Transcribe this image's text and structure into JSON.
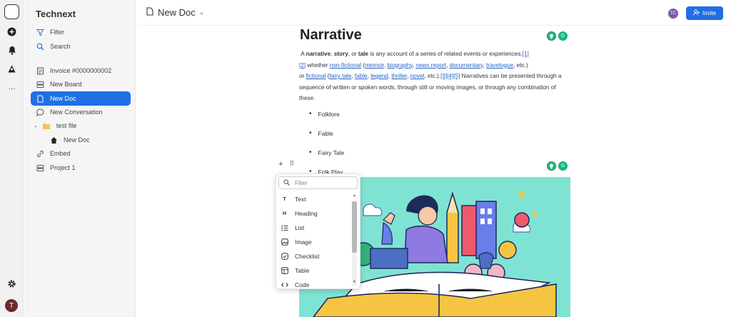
{
  "app": {
    "name": "Technext"
  },
  "rail": {
    "icons": [
      "app-logo-icon",
      "plus-circle-icon",
      "bell-icon",
      "spaces-icon",
      "more-icon",
      "settings-gear-icon"
    ],
    "avatar_initial": "T"
  },
  "sidebar": {
    "filter_label": "Filter",
    "search_label": "Search",
    "items": [
      {
        "label": "Invoice #0000000002",
        "icon": "invoice-icon"
      },
      {
        "label": "New Board",
        "icon": "board-icon"
      },
      {
        "label": "New Doc",
        "icon": "doc-icon",
        "active": true
      },
      {
        "label": "New Conversation",
        "icon": "chat-icon"
      },
      {
        "label": "test file",
        "icon": "folder-icon"
      },
      {
        "label": "New Doc",
        "icon": "home-icon"
      },
      {
        "label": "Embed",
        "icon": "link-icon"
      },
      {
        "label": "Project 1",
        "icon": "project-icon"
      }
    ]
  },
  "topbar": {
    "doc_title": "New Doc",
    "user_initials": "TC",
    "invite_label": "Invite"
  },
  "document": {
    "heading": "Narrative",
    "para": {
      "t1": "A ",
      "b1": "narrative",
      "t2": ", ",
      "b2": "story",
      "t3": ", or ",
      "b3": "tale",
      "t4": " is any account of a series of related events or experiences.",
      "r1": "[1]",
      "r2": "[2]",
      "t5": " whether ",
      "l1": "non-fictional",
      "t6": " (",
      "l2": "memoir",
      "t7": ", ",
      "l3": "biography",
      "t8": ", ",
      "l4": "news report",
      "t9": ", ",
      "l5": "documentary",
      "t10": ", ",
      "l6": "travelogue",
      "t11": ", etc.)",
      "t12": "or ",
      "l7": "fictional",
      "t13": " (",
      "l8": "fairy tale",
      "t14": ", ",
      "l9": "fable",
      "t15": ", ",
      "l10": "legend",
      "t16": ", ",
      "l11": "thriller",
      "t17": ", ",
      "l12": "novel",
      "t18": ", etc.).",
      "r3": "[3]",
      "r4": "[4]",
      "r5": "[5]",
      "t19": " Narratives can be presented through a sequence of written or spoken words, through still or moving images, or through any combination of these."
    },
    "bullets": [
      "Folklore",
      "Fable",
      "Fairy Tale",
      "Folk Play"
    ]
  },
  "slash_menu": {
    "filter_placeholder": "Filter",
    "items": [
      {
        "label": "Text",
        "icon": "text-icon"
      },
      {
        "label": "Heading",
        "icon": "heading-icon"
      },
      {
        "label": "List",
        "icon": "list-icon"
      },
      {
        "label": "Image",
        "icon": "image-icon"
      },
      {
        "label": "Checklist",
        "icon": "checklist-icon"
      },
      {
        "label": "Table",
        "icon": "table-icon"
      },
      {
        "label": "Code",
        "icon": "code-icon"
      }
    ]
  },
  "colors": {
    "accent": "#1f6fe5",
    "illustration_bg": "#7fe3d4",
    "grammarly": "#15b57e"
  }
}
